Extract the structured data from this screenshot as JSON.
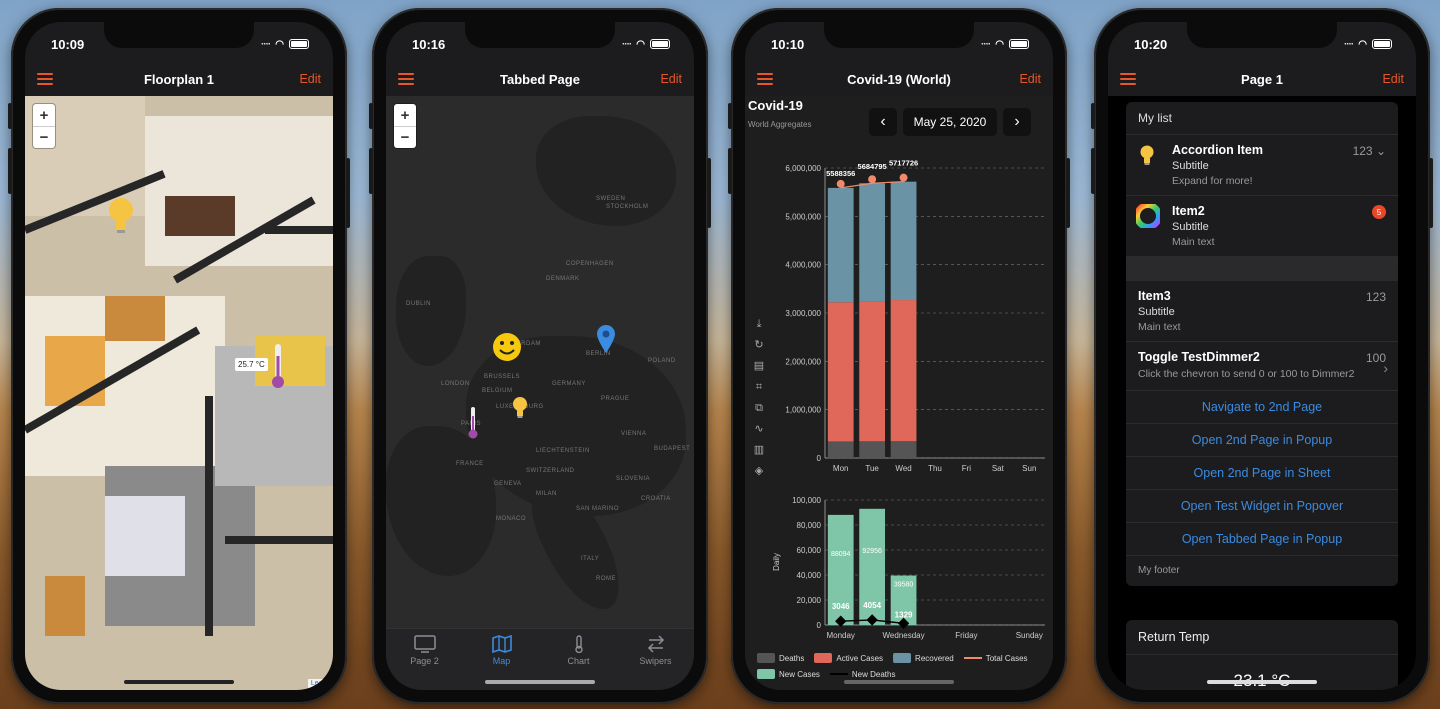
{
  "phones": [
    {
      "status": {
        "time": "10:09"
      },
      "nav": {
        "title": "Floorplan 1",
        "edit": "Edit"
      },
      "zoom": {
        "in": "+",
        "out": "−"
      },
      "floorplan": {
        "temperature_label": "25.7 °C",
        "attribution": "Leafl"
      }
    },
    {
      "status": {
        "time": "10:16"
      },
      "nav": {
        "title": "Tabbed Page",
        "edit": "Edit"
      },
      "zoom": {
        "in": "+",
        "out": "−"
      },
      "map_labels": [
        "SWEDEN",
        "STOCKHOLM",
        "DENMARK",
        "BERLIN",
        "POLAND",
        "BELGIUM",
        "GERMANY",
        "LUXEMBOURG",
        "FRANCE",
        "SWITZERLAND",
        "LIECHTENSTEIN",
        "SLOVENIA",
        "MONACO",
        "SAN MARINO",
        "CROATIA",
        "ITALY",
        "DUBLIN",
        "AMSTERDAM",
        "PARIS",
        "GENEVA",
        "PRAGUE",
        "VIENNA",
        "BUDAPEST",
        "COPENHAGEN",
        "LONDON",
        "BRUSSELS",
        "MILAN",
        "ROME"
      ],
      "tabs": [
        {
          "label": "Page 2",
          "icon": "monitor-icon"
        },
        {
          "label": "Map",
          "icon": "map-icon"
        },
        {
          "label": "Chart",
          "icon": "thermometer-icon"
        },
        {
          "label": "Swipers",
          "icon": "swap-icon"
        }
      ]
    },
    {
      "status": {
        "time": "10:10"
      },
      "nav": {
        "title": "Covid-19 (World)",
        "edit": "Edit"
      },
      "header": {
        "title": "Covid-19",
        "subtitle": "World Aggregates",
        "date": "May 25, 2020",
        "prev": "‹",
        "next": "›"
      },
      "toolbar": [
        "download-icon",
        "refresh-icon",
        "document-icon",
        "crop-icon",
        "crop-rotate-icon",
        "line-chart-icon",
        "bar-chart-icon",
        "stack-icon"
      ]
    },
    {
      "status": {
        "time": "10:20"
      },
      "nav": {
        "title": "Page 1",
        "edit": "Edit"
      },
      "list": {
        "header": "My list",
        "items": [
          {
            "title": "Accordion Item",
            "subtitle": "Subtitle",
            "text": "Expand for more!",
            "value": "123",
            "icon": "lightbulb-icon"
          },
          {
            "title": "Item2",
            "subtitle": "Subtitle",
            "text": "Main text",
            "badge": "5",
            "icon": "color-wheel-icon"
          }
        ],
        "item3": {
          "title": "Item3",
          "subtitle": "Subtitle",
          "text": "Main text",
          "value": "123"
        },
        "toggle": {
          "title": "Toggle TestDimmer2",
          "text": "Click the chevron to send 0 or 100 to Dimmer2",
          "value": "100"
        },
        "links": [
          "Navigate to 2nd Page",
          "Open 2nd Page in Popup",
          "Open 2nd Page in Sheet",
          "Open Test Widget in Popover",
          "Open Tabbed Page in Popup"
        ],
        "footer": "My footer"
      },
      "card2": {
        "title": "Return Temp",
        "value": "23.1 °C"
      }
    }
  ],
  "colors": {
    "accent": "#e8572a",
    "link": "#3b8be0",
    "deaths": "#555555",
    "active": "#e0685a",
    "recovered": "#6a93a6",
    "new_cases": "#7fc6a9"
  },
  "chart_data": [
    {
      "type": "bar",
      "stacked": true,
      "categories": [
        "Mon",
        "Tue",
        "Wed",
        "Thu",
        "Fri",
        "Sat",
        "Sun"
      ],
      "series": [
        {
          "name": "Deaths",
          "values": [
            343000,
            346000,
            348000,
            null,
            null,
            null,
            null
          ]
        },
        {
          "name": "Active Cases",
          "values": [
            2880000,
            2900000,
            2920000,
            null,
            null,
            null,
            null
          ]
        },
        {
          "name": "Recovered",
          "values": [
            2365356,
            2438795,
            2449726,
            null,
            null,
            null,
            null
          ]
        },
        {
          "name": "Total Cases",
          "type": "line",
          "values": [
            5588356,
            5684795,
            5717726,
            null,
            null,
            null,
            null
          ],
          "labels": [
            "5588356",
            "5684795",
            "5717726"
          ]
        }
      ],
      "y_ticks": [
        "0",
        "1,000,000",
        "2,000,000",
        "3,000,000",
        "4,000,000",
        "5,000,000",
        "6,000,000"
      ],
      "ylim": [
        0,
        6000000
      ],
      "grid": true
    },
    {
      "type": "bar",
      "categories": [
        "Monday",
        "Tuesday",
        "Wednesday",
        "Thursday",
        "Friday",
        "Saturday",
        "Sunday"
      ],
      "x_ticks": [
        "Monday",
        "Wednesday",
        "Friday",
        "Sunday"
      ],
      "ylabel": "Daily",
      "series": [
        {
          "name": "New Cases",
          "values": [
            88094,
            92956,
            39580,
            null,
            null,
            null,
            null
          ],
          "labels": [
            "88094",
            "92956",
            "39580"
          ]
        },
        {
          "name": "New Deaths",
          "type": "line",
          "values": [
            3046,
            4054,
            1329,
            null,
            null,
            null,
            null
          ],
          "labels": [
            "3046",
            "4054",
            "1329"
          ]
        }
      ],
      "y_ticks": [
        "0",
        "20,000",
        "40,000",
        "60,000",
        "80,000",
        "100,000"
      ],
      "ylim": [
        0,
        100000
      ],
      "grid": true
    }
  ],
  "legend": [
    {
      "label": "Deaths",
      "kind": "box"
    },
    {
      "label": "Active Cases",
      "kind": "box"
    },
    {
      "label": "Recovered",
      "kind": "box"
    },
    {
      "label": "Total Cases",
      "kind": "line"
    },
    {
      "label": "New Cases",
      "kind": "box"
    },
    {
      "label": "New Deaths",
      "kind": "line"
    }
  ]
}
